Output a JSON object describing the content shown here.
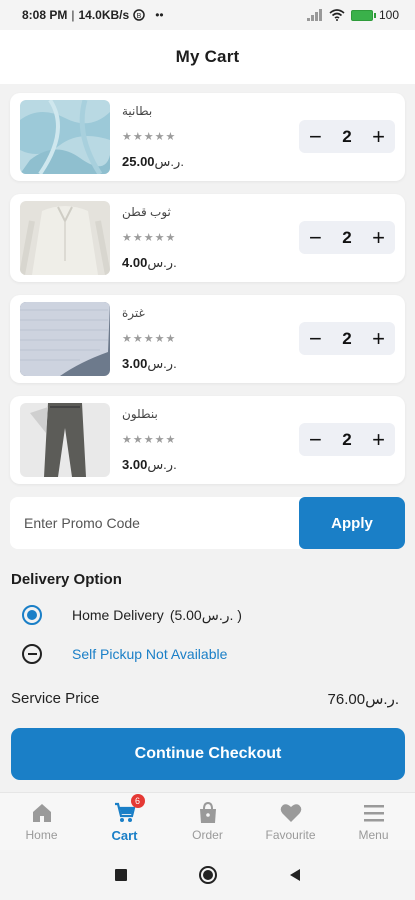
{
  "status_bar": {
    "time": "8:08 PM",
    "speed": "14.0KB/s",
    "extra": "••",
    "battery": "100"
  },
  "header": {
    "title": "My Cart"
  },
  "cart": {
    "items": [
      {
        "name": "بطانية",
        "rating": "★★★★★",
        "price": "25.00",
        "currency": "ر.س.",
        "qty": "2",
        "image": "blanket"
      },
      {
        "name": "ثوب قطن",
        "rating": "★★★★★",
        "price": "4.00",
        "currency": "ر.س.",
        "qty": "2",
        "image": "cotton-thobe"
      },
      {
        "name": "غترة",
        "rating": "★★★★★",
        "price": "3.00",
        "currency": "ر.س.",
        "qty": "2",
        "image": "ghutra"
      },
      {
        "name": "بنطلون",
        "rating": "★★★★★",
        "price": "3.00",
        "currency": "ر.س.",
        "qty": "2",
        "image": "trousers"
      }
    ],
    "minus_label": "−",
    "plus_label": "+"
  },
  "promo": {
    "placeholder": "Enter Promo Code",
    "apply_label": "Apply"
  },
  "delivery": {
    "title": "Delivery Option",
    "home_label": "Home Delivery",
    "home_price": "(5.00ر.س. )",
    "pickup_label": "Self Pickup Not Available"
  },
  "service": {
    "label": "Service Price",
    "value": "76.00ر.س."
  },
  "checkout": {
    "label": "Continue Checkout"
  },
  "bottom_nav": {
    "items": [
      {
        "label": "Home",
        "icon": "home-icon"
      },
      {
        "label": "Cart",
        "icon": "cart-icon",
        "badge": "6"
      },
      {
        "label": "Order",
        "icon": "bag-icon"
      },
      {
        "label": "Favourite",
        "icon": "heart-icon"
      },
      {
        "label": "Menu",
        "icon": "menu-icon"
      }
    ],
    "active_color": "#1a7fc7"
  },
  "colors": {
    "accent": "#1a7fc7"
  }
}
